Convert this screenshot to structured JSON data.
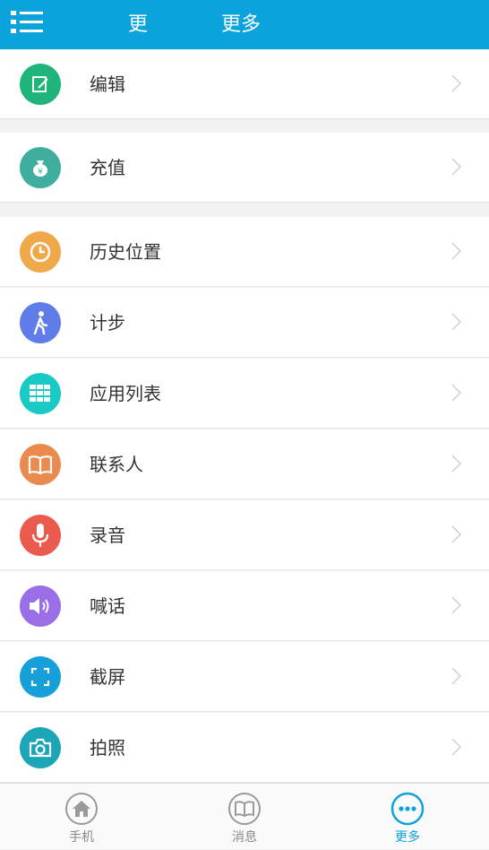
{
  "header": {
    "title_left": "更",
    "title_right": "更多"
  },
  "colors": {
    "primary": "#0aa3db",
    "edit": "#1fb57a",
    "recharge": "#3fae9f",
    "history": "#f0a94a",
    "steps": "#5f7de8",
    "apps": "#19c9c3",
    "contacts": "#ea8a4f",
    "record": "#ea5b4d",
    "shout": "#9a6ee6",
    "screenshot": "#169fd9",
    "photo": "#1ba6b8"
  },
  "menu": {
    "items": [
      {
        "label": "编辑",
        "icon": "edit-icon"
      },
      {
        "label": "充值",
        "icon": "money-bag-icon"
      },
      {
        "label": "历史位置",
        "icon": "clock-icon"
      },
      {
        "label": "计步",
        "icon": "walk-icon"
      },
      {
        "label": "应用列表",
        "icon": "grid-icon"
      },
      {
        "label": "联系人",
        "icon": "book-icon"
      },
      {
        "label": "录音",
        "icon": "microphone-icon"
      },
      {
        "label": "喊话",
        "icon": "speaker-icon"
      },
      {
        "label": "截屏",
        "icon": "screenshot-icon"
      },
      {
        "label": "拍照",
        "icon": "camera-icon"
      }
    ]
  },
  "tabs": [
    {
      "label": "手机",
      "icon": "home-icon",
      "active": false
    },
    {
      "label": "消息",
      "icon": "book-icon",
      "active": false
    },
    {
      "label": "更多",
      "icon": "more-icon",
      "active": true
    }
  ]
}
